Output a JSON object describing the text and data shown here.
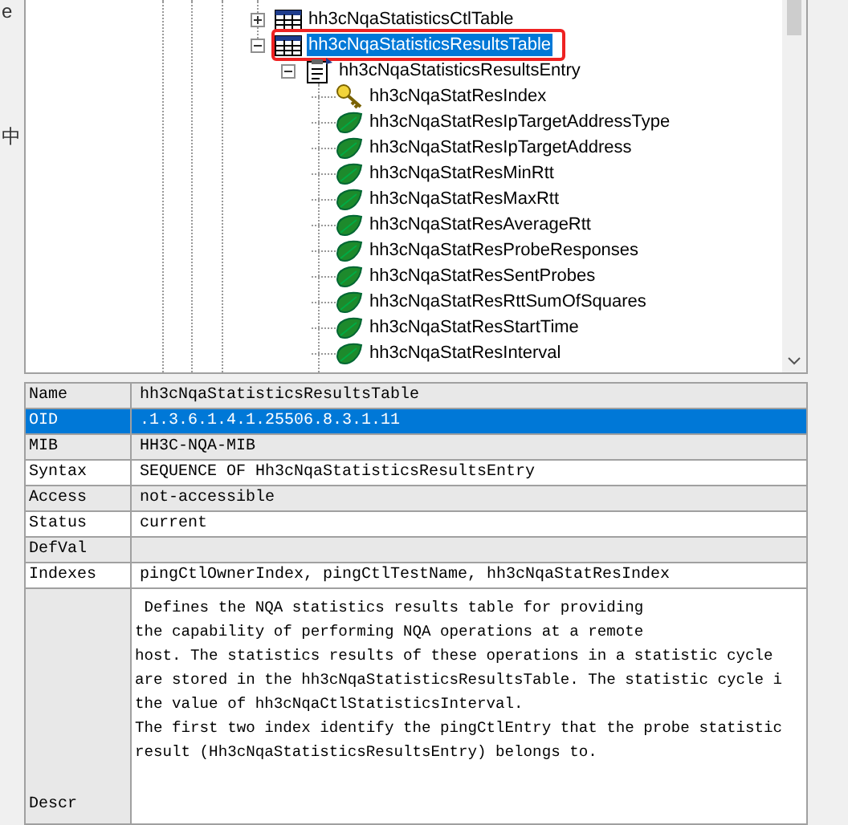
{
  "left_edge": {
    "texts": [
      "e",
      "中"
    ]
  },
  "tree": {
    "nodes": [
      {
        "label": "hh3cNqaStatisticsCtlTable",
        "kind": "table",
        "expanded": false,
        "selected": false
      },
      {
        "label": "hh3cNqaStatisticsResultsTable",
        "kind": "table",
        "expanded": true,
        "selected": true,
        "annotated": true,
        "children": [
          {
            "label": "hh3cNqaStatisticsResultsEntry",
            "kind": "entry",
            "expanded": true,
            "selected": false,
            "children": [
              {
                "label": "hh3cNqaStatResIndex",
                "kind": "index",
                "selected": false,
                "annotated": false
              },
              {
                "label": "hh3cNqaStatResIpTargetAddressType",
                "kind": "leaf",
                "selected": false,
                "annotated": false
              },
              {
                "label": "hh3cNqaStatResIpTargetAddress",
                "kind": "leaf",
                "selected": false,
                "annotated": false
              },
              {
                "label": "hh3cNqaStatResMinRtt",
                "kind": "leaf",
                "selected": false,
                "annotated": false
              },
              {
                "label": "hh3cNqaStatResMaxRtt",
                "kind": "leaf",
                "selected": false,
                "annotated": false
              },
              {
                "label": "hh3cNqaStatResAverageRtt",
                "kind": "leaf",
                "selected": false,
                "annotated": false
              },
              {
                "label": "hh3cNqaStatResProbeResponses",
                "kind": "leaf",
                "selected": false,
                "annotated": false
              },
              {
                "label": "hh3cNqaStatResSentProbes",
                "kind": "leaf",
                "selected": false,
                "annotated": false
              },
              {
                "label": "hh3cNqaStatResRttSumOfSquares",
                "kind": "leaf",
                "selected": false,
                "annotated": false
              },
              {
                "label": "hh3cNqaStatResStartTime",
                "kind": "leaf",
                "selected": false,
                "annotated": false
              },
              {
                "label": "hh3cNqaStatResInterval",
                "kind": "leaf",
                "selected": false,
                "annotated": false
              }
            ]
          }
        ]
      }
    ]
  },
  "properties": {
    "rows": [
      {
        "name": "Name",
        "value": "hh3cNqaStatisticsResultsTable",
        "selected": false
      },
      {
        "name": "OID",
        "value": ".1.3.6.1.4.1.25506.8.3.1.11",
        "selected": true
      },
      {
        "name": "MIB",
        "value": "HH3C-NQA-MIB",
        "selected": false
      },
      {
        "name": "Syntax",
        "value": "SEQUENCE OF Hh3cNqaStatisticsResultsEntry",
        "selected": false
      },
      {
        "name": "Access",
        "value": "not-accessible",
        "selected": false
      },
      {
        "name": "Status",
        "value": "current",
        "selected": false
      },
      {
        "name": "DefVal",
        "value": "",
        "selected": false
      },
      {
        "name": "Indexes",
        "value": "pingCtlOwnerIndex, pingCtlTestName, hh3cNqaStatResIndex",
        "selected": false
      }
    ],
    "description": {
      "name": "Descr",
      "lines": [
        " Defines the NQA statistics results table for providing",
        "the capability of performing NQA operations at a remote",
        "host. The statistics results of these operations in a statistic cycle",
        "are stored in the hh3cNqaStatisticsResultsTable. The statistic cycle i",
        "the value of hh3cNqaCtlStatisticsInterval.",
        "The first two index identify the pingCtlEntry that the probe statistic",
        "result (Hh3cNqaStatisticsResultsEntry) belongs to."
      ]
    }
  }
}
